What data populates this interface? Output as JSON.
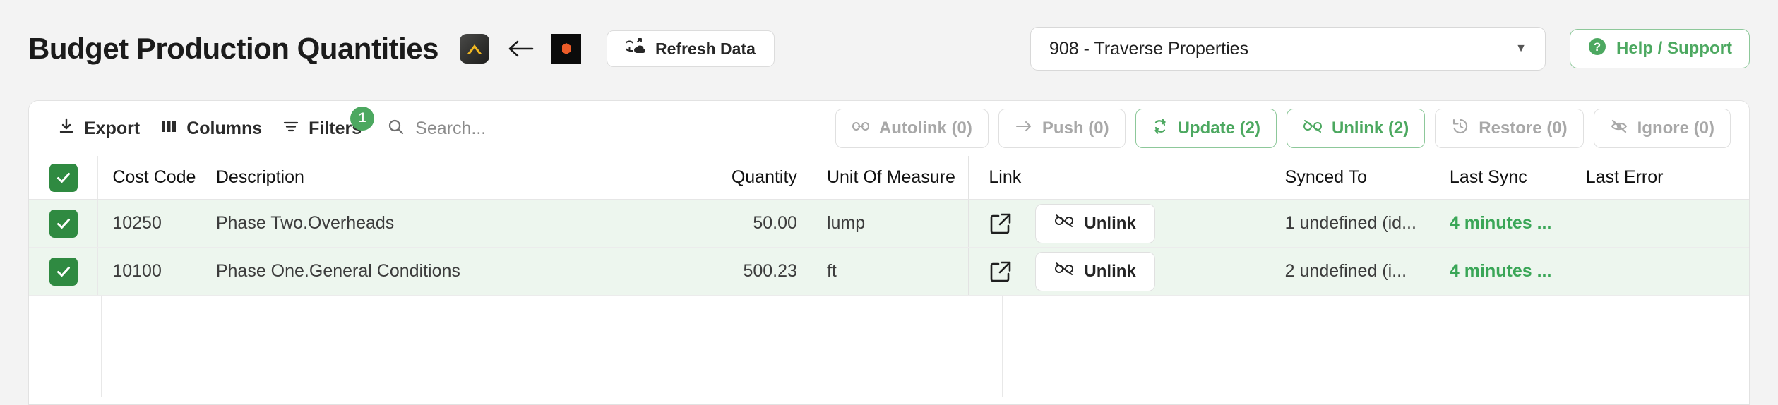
{
  "header": {
    "title": "Budget Production Quantities",
    "icons": [
      {
        "name": "acumatica-logo-icon"
      },
      {
        "name": "back-arrow-icon"
      },
      {
        "name": "procore-logo-icon"
      }
    ],
    "refresh_label": "Refresh Data",
    "refresh_icon": "cloud-refresh-icon",
    "project_value": "908 - Traverse Properties",
    "project_caret_icon": "chevron-down-icon",
    "help_label": "Help / Support",
    "help_icon": "question-circle-icon"
  },
  "toolbar": {
    "export_label": "Export",
    "export_icon": "download-icon",
    "columns_label": "Columns",
    "columns_icon": "columns-icon",
    "filters_label": "Filters",
    "filters_icon": "filter-icon",
    "filters_badge": "1",
    "search_icon": "search-icon",
    "search_value": "",
    "search_placeholder": "Search...",
    "actions": [
      {
        "label": "Autolink (0)",
        "icon": "link-icon",
        "state": "disabled"
      },
      {
        "label": "Push (0)",
        "icon": "arrow-right-icon",
        "state": "disabled"
      },
      {
        "label": "Update (2)",
        "icon": "refresh-cw-icon",
        "state": "active"
      },
      {
        "label": "Unlink (2)",
        "icon": "unlink-icon",
        "state": "active"
      },
      {
        "label": "Restore (0)",
        "icon": "history-icon",
        "state": "disabled"
      },
      {
        "label": "Ignore (0)",
        "icon": "eye-off-icon",
        "state": "disabled"
      }
    ]
  },
  "table": {
    "select_all_checked": true,
    "columns": [
      "Cost Code",
      "Description",
      "Quantity",
      "Unit Of Measure",
      "Link",
      "Synced To",
      "Last Sync",
      "Last Error"
    ],
    "rows": [
      {
        "checked": true,
        "cost_code": "10250",
        "description": "Phase Two.Overheads",
        "quantity": "50.00",
        "unit_of_measure": "lump",
        "link_icon": "external-link-icon",
        "unlink_label": "Unlink",
        "unlink_icon": "unlink-icon",
        "synced_to": "1 undefined (id...",
        "last_sync": "4 minutes ...",
        "last_error": ""
      },
      {
        "checked": true,
        "cost_code": "10100",
        "description": "Phase One.General Conditions",
        "quantity": "500.23",
        "unit_of_measure": "ft",
        "link_icon": "external-link-icon",
        "unlink_label": "Unlink",
        "unlink_icon": "unlink-icon",
        "synced_to": "2 undefined (i...",
        "last_sync": "4 minutes ...",
        "last_error": ""
      }
    ]
  },
  "colors": {
    "accent_green": "#4ca860",
    "checkbox_green": "#2f8a41",
    "row_selected_bg": "#edf6ee",
    "sync_text_green": "#3aa657",
    "procore_orange": "#ec5c29",
    "acumatica_gold": "#f0b722",
    "page_bg": "#f3f3f3"
  }
}
